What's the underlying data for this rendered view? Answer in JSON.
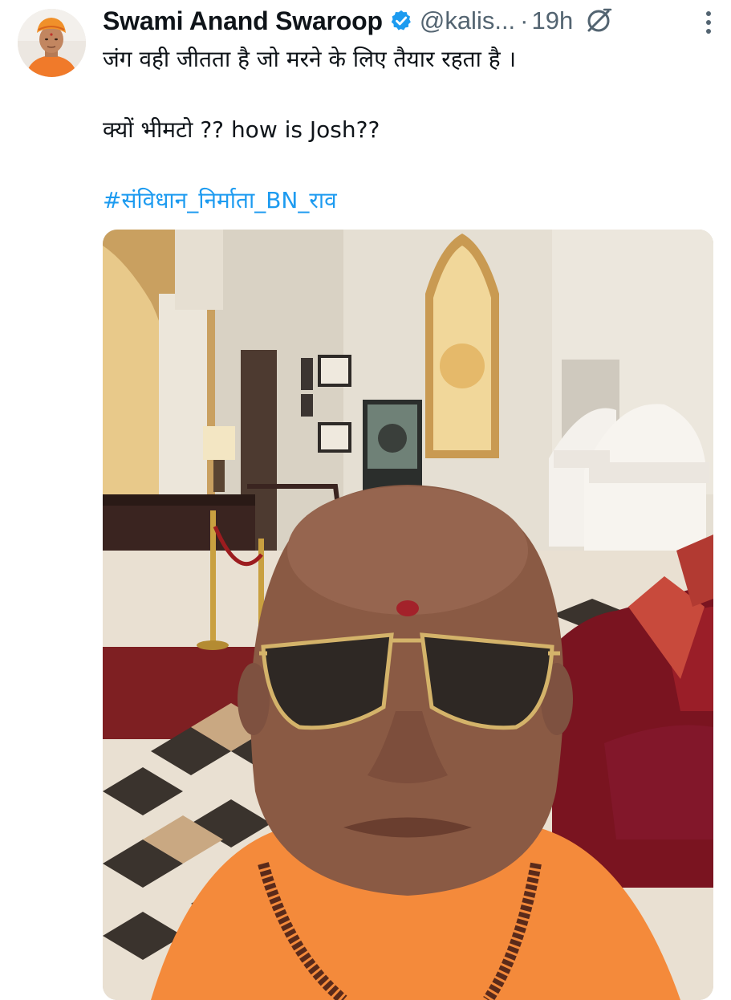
{
  "user": {
    "display_name": "Swami Anand Swaroop",
    "handle": "@kalis...",
    "separator": "·",
    "time": "19h",
    "verified": true,
    "avatar_icon": "avatar-photo",
    "verified_icon": "verified-badge-icon",
    "grok_icon": "grok-icon",
    "more_icon": "more-options-icon"
  },
  "tweet": {
    "line1": "जंग वही जीतता  है जो मरने के लिए तैयार रहता है ।",
    "line2": "क्यों भीमटो ?? how is Josh??",
    "hashtag": "#संविधान_निर्माता_BN_राव"
  },
  "colors": {
    "text": "#0f1419",
    "secondary": "#536471",
    "link": "#1d9bf0",
    "verified": "#1d9bf0"
  }
}
